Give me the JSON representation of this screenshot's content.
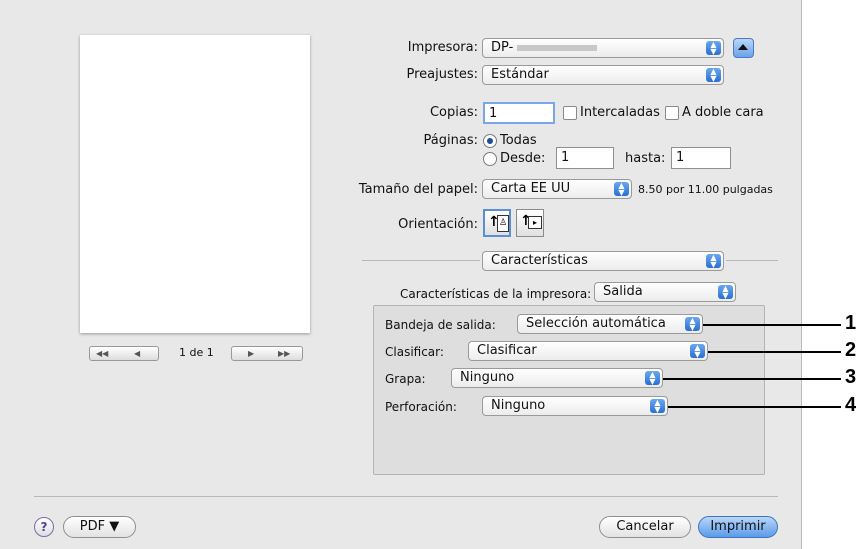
{
  "preview": {
    "page_indicator": "1 de 1",
    "first_icon": "◀◀",
    "prev_icon": "◀",
    "next_icon": "▶",
    "last_icon": "▶▶"
  },
  "printer": {
    "label": "Impresora:",
    "value": "DP-"
  },
  "presets": {
    "label": "Preajustes:",
    "value": "Estándar"
  },
  "copies": {
    "label": "Copias:",
    "value": "1",
    "collated_label": "Intercaladas",
    "duplex_label": "A doble cara"
  },
  "pages": {
    "label": "Páginas:",
    "all_label": "Todas",
    "from_label": "Desde:",
    "from_value": "1",
    "to_label": "hasta:",
    "to_value": "1"
  },
  "paper": {
    "label": "Tamaño del papel:",
    "value": "Carta EE UU",
    "size_text": "8.50 por 11.00 pulgadas"
  },
  "orientation": {
    "label": "Orientación:"
  },
  "section": {
    "value": "Características"
  },
  "features": {
    "label": "Características de la impresora:",
    "value": "Salida"
  },
  "output_tray": {
    "label": "Bandeja de salida:",
    "value": "Selección automática"
  },
  "sort": {
    "label": "Clasificar:",
    "value": "Clasificar"
  },
  "staple": {
    "label": "Grapa:",
    "value": "Ninguno"
  },
  "punch": {
    "label": "Perforación:",
    "value": "Ninguno"
  },
  "footer": {
    "help": "?",
    "pdf_label": "PDF ▼",
    "cancel_label": "Cancelar",
    "print_label": "Imprimir"
  },
  "callouts": [
    "1",
    "2",
    "3",
    "4"
  ],
  "colors": {
    "accent": "#2a6fd2",
    "dialog_bg": "#e8e8e8"
  }
}
